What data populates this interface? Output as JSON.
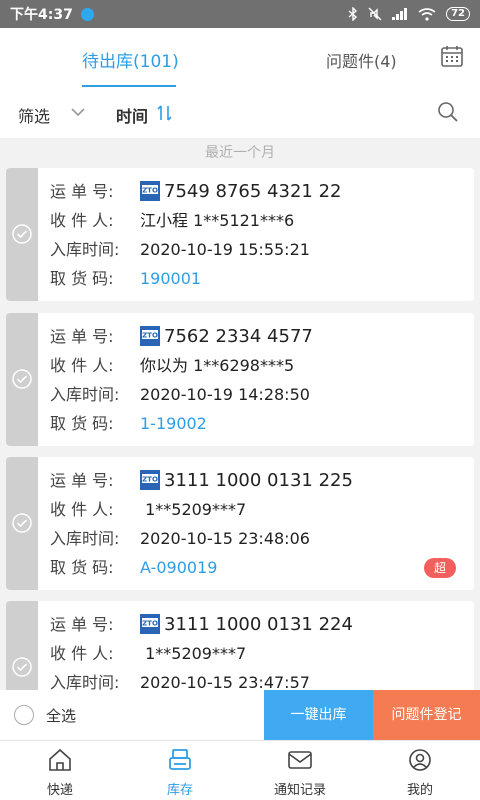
{
  "status": {
    "time": "下午4:37",
    "battery": "72"
  },
  "tabs": {
    "main": "待出库(101)",
    "issue": "问题件(4)"
  },
  "filter": {
    "label": "筛选",
    "sort": "时间"
  },
  "period": "最近一个月",
  "labels": {
    "waybill": "运 单 号:",
    "receiver": "收 件 人:",
    "time": "入库时间:",
    "code": "取 货 码:"
  },
  "cards": [
    {
      "waybill": "7549 8765 4321 22",
      "receiver": "江小程 1**5121***6",
      "time": "2020-10-19 15:55:21",
      "code": "190001"
    },
    {
      "waybill": "7562 2334 4577",
      "receiver": "你以为 1**6298***5",
      "time": "2020-10-19 14:28:50",
      "code": "1-19002"
    },
    {
      "waybill": "3111 1000 0131 225",
      "receiver": " 1**5209***7",
      "time": "2020-10-15 23:48:06",
      "code": "A-090019",
      "badge": "超"
    },
    {
      "waybill": "3111 1000 0131 224",
      "receiver": " 1**5209***7",
      "time": "2020-10-15 23:47:57",
      "code": ""
    }
  ],
  "actions": {
    "select_all": "全选",
    "checkout": "一键出库",
    "issue_register": "问题件登记"
  },
  "tabbar": {
    "express": "快递",
    "inventory": "库存",
    "notify": "通知记录",
    "mine": "我的"
  },
  "colors": {
    "accent": "#2d9ee6",
    "orange": "#f57b53",
    "badge": "#f1605c"
  }
}
